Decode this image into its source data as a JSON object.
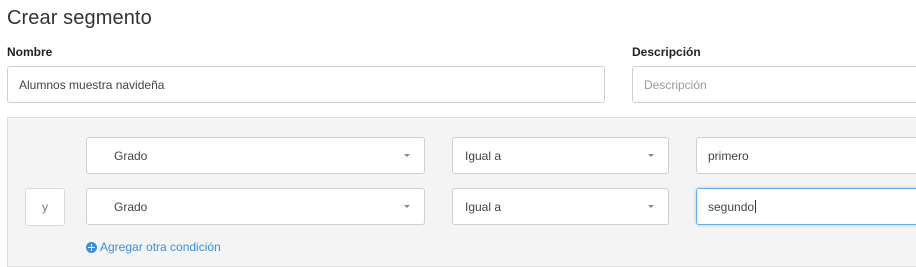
{
  "page": {
    "title": "Crear segmento"
  },
  "form": {
    "name_label": "Nombre",
    "name_value": "Alumnos muestra navideña",
    "description_label": "Descripción",
    "description_placeholder": "Descripción"
  },
  "conditions": {
    "connector_label": "y",
    "rows": [
      {
        "field": "Grado",
        "operator": "Igual a",
        "value": "primero"
      },
      {
        "field": "Grado",
        "operator": "Igual a",
        "value": "segundo"
      }
    ],
    "add_label": "Agregar otra condición"
  },
  "icons": {
    "dropdown": "chevron-down-icon",
    "add": "plus-circle-icon"
  },
  "colors": {
    "link": "#3a8fd6",
    "focus": "#66afe9",
    "panel_bg": "#f4f4f4"
  }
}
